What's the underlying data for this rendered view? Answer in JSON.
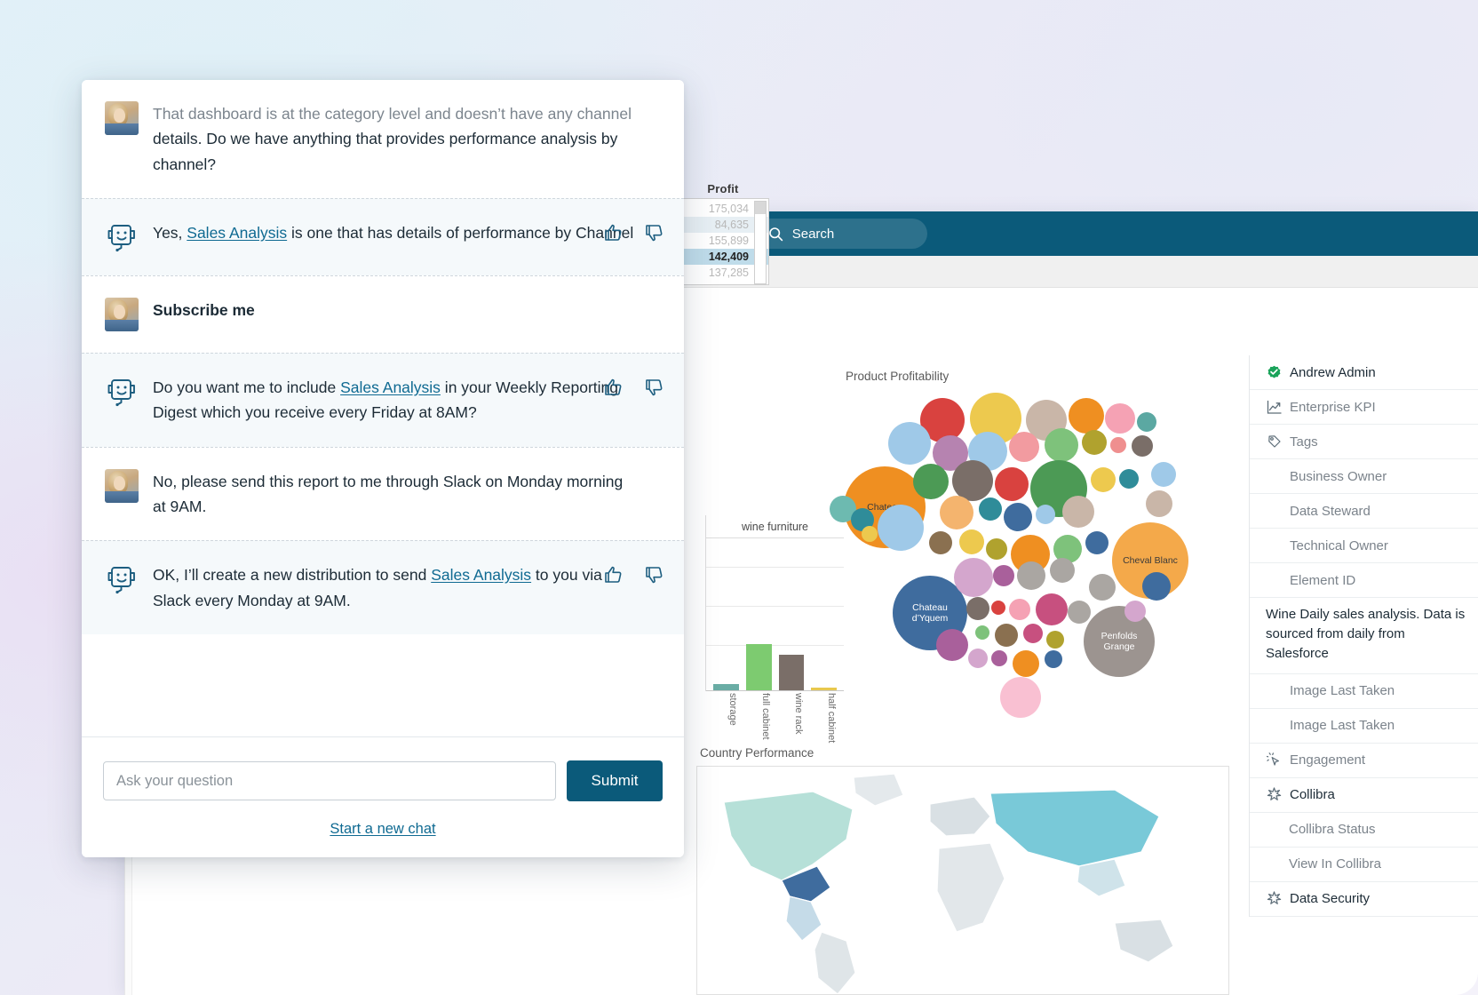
{
  "chat": {
    "messages": [
      {
        "role": "user",
        "text": "That dashboard is at the category level and doesn’t have any channel details. Do we have anything that provides performance analysis by channel?"
      },
      {
        "role": "bot",
        "pre": "Yes, ",
        "link": "Sales Analysis",
        "post": " is one that has details of performance by Channel"
      },
      {
        "role": "user",
        "text": "Subscribe me",
        "bold": true
      },
      {
        "role": "bot",
        "pre": "Do you want me to include ",
        "link": "Sales Analysis",
        "post": " in your Weekly Reporting Digest which you receive every Friday at 8AM?"
      },
      {
        "role": "user",
        "text": "No, please send this report to me through Slack on Monday morning at 9AM."
      },
      {
        "role": "bot",
        "pre": "OK, I’ll create a new distribution to send ",
        "link": "Sales Analysis",
        "post": " to you via Slack every Monday at 9AM."
      }
    ],
    "input_placeholder": "Ask your question",
    "submit_label": "Submit",
    "new_chat_label": "Start a new chat",
    "thumbs_up_icon": "thumbs-up-icon",
    "thumbs_down_icon": "thumbs-down-icon",
    "bot_icon": "chatbot-icon"
  },
  "app": {
    "search_placeholder": "Search",
    "search_icon": "search-icon"
  },
  "metadata": {
    "rows": [
      {
        "label": "Andrew Admin",
        "icon": "verified-check-icon",
        "bold": true,
        "indent": false
      },
      {
        "label": "Enterprise KPI",
        "icon": "trend-line-icon",
        "bold": false,
        "indent": false
      },
      {
        "label": "Tags",
        "icon": "tag-icon",
        "bold": false,
        "indent": false
      },
      {
        "label": "Business Owner",
        "icon": "",
        "bold": false,
        "indent": false
      },
      {
        "label": "Data Steward",
        "icon": "",
        "bold": false,
        "indent": false
      },
      {
        "label": "Technical Owner",
        "icon": "",
        "bold": false,
        "indent": false
      },
      {
        "label": "Element ID",
        "icon": "",
        "bold": false,
        "indent": false
      },
      {
        "label": "Wine Daily sales analysis. Data is sourced from daily from Salesforce",
        "icon": "",
        "bold": true,
        "indent": false,
        "desc": true
      },
      {
        "label": "Image Last Taken",
        "icon": "",
        "bold": false,
        "indent": false
      },
      {
        "label": "Image Last Taken",
        "icon": "",
        "bold": false,
        "indent": false
      },
      {
        "label": "Engagement",
        "icon": "cursor-click-icon",
        "bold": false,
        "indent": false
      },
      {
        "label": "Collibra",
        "icon": "asterisk-icon",
        "bold": true,
        "indent": false
      },
      {
        "label": "Collibra Status",
        "icon": "",
        "bold": false,
        "indent": true
      },
      {
        "label": "View In Collibra",
        "icon": "",
        "bold": false,
        "indent": true
      },
      {
        "label": "Data Security",
        "icon": "asterisk-icon",
        "bold": true,
        "indent": false
      }
    ]
  },
  "chart_data": [
    {
      "type": "table",
      "title": "Profit",
      "values": [
        "175,034",
        "84,635",
        "155,899",
        "142,409",
        "137,285"
      ],
      "selected": "142,409"
    },
    {
      "type": "bar",
      "title": "wine furniture",
      "categories": [
        "storage",
        "full cabinet",
        "wine rack",
        "half cabinet"
      ],
      "values": [
        4,
        52,
        40,
        2
      ],
      "colors": [
        "#6aada5",
        "#7dcb70",
        "#7a6e68",
        "#e8c84e"
      ],
      "ylim": [
        0,
        170
      ],
      "grid": true
    },
    {
      "type": "scatter",
      "title": "Product Profitability",
      "labels": [
        "Chateau",
        "Cheval Blanc",
        "Chateau d’Yquem",
        "Penfolds Grange"
      ]
    },
    {
      "type": "heatmap",
      "title": "Country Performance"
    }
  ]
}
